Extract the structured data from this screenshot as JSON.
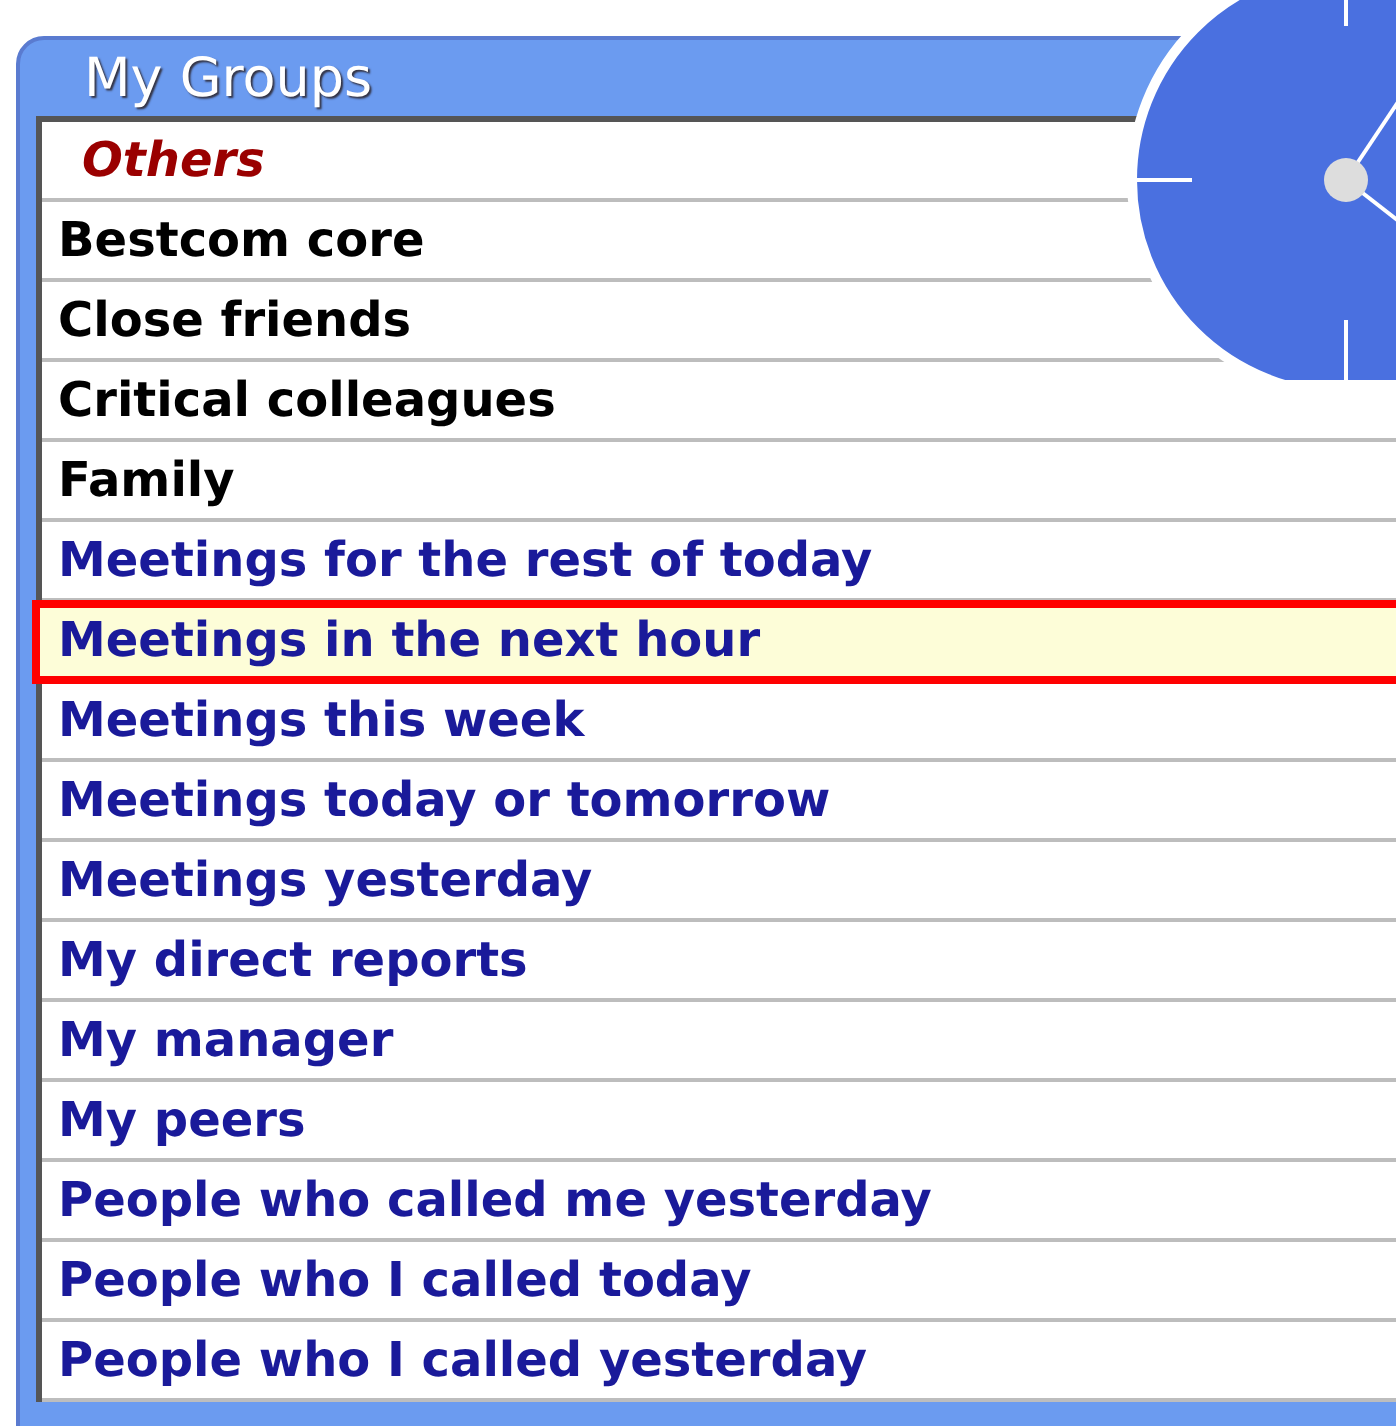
{
  "panel": {
    "title": "My Groups"
  },
  "groups": [
    {
      "label": "Others",
      "kind": "category",
      "selected": false
    },
    {
      "label": "Bestcom core",
      "kind": "group",
      "selected": false
    },
    {
      "label": "Close friends",
      "kind": "group",
      "selected": false
    },
    {
      "label": "Critical colleagues",
      "kind": "group",
      "selected": false
    },
    {
      "label": "Family",
      "kind": "group",
      "selected": false
    },
    {
      "label": "Meetings for the rest of today",
      "kind": "smart",
      "selected": false
    },
    {
      "label": "Meetings in the next hour",
      "kind": "smart",
      "selected": true
    },
    {
      "label": "Meetings this week",
      "kind": "smart",
      "selected": false
    },
    {
      "label": "Meetings today or tomorrow",
      "kind": "smart",
      "selected": false
    },
    {
      "label": "Meetings yesterday",
      "kind": "smart",
      "selected": false
    },
    {
      "label": "My direct reports",
      "kind": "smart",
      "selected": false
    },
    {
      "label": "My manager",
      "kind": "smart",
      "selected": false
    },
    {
      "label": "My peers",
      "kind": "smart",
      "selected": false
    },
    {
      "label": "People who called me yesterday",
      "kind": "smart",
      "selected": false
    },
    {
      "label": "People who I called today",
      "kind": "smart",
      "selected": false
    },
    {
      "label": "People who I called yesterday",
      "kind": "smart",
      "selected": false
    }
  ]
}
